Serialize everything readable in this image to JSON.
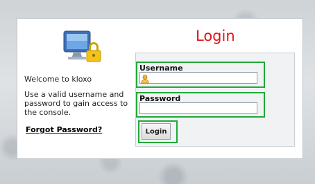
{
  "header": {
    "title": "Login"
  },
  "left": {
    "welcome": "Welcome to kloxo",
    "help": "Use a valid username and password to gain access to the console.",
    "forgot": "Forgot Password?"
  },
  "form": {
    "username_label": "Username",
    "username_value": "",
    "password_label": "Password",
    "password_value": "",
    "submit_label": "Login"
  },
  "icons": {
    "brand": "computer-padlock-icon",
    "user": "user-icon"
  },
  "colors": {
    "title": "#e01414",
    "highlight": "#21a83a"
  }
}
